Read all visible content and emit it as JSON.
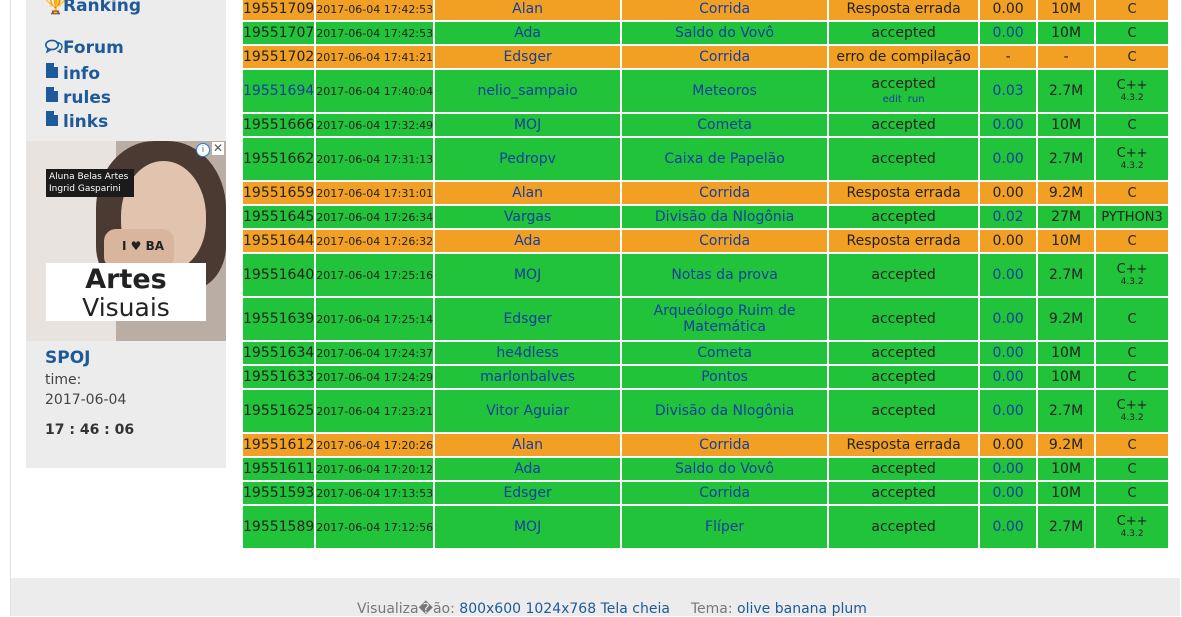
{
  "nav": {
    "ranking": "Ranking",
    "forum": "Forum",
    "info": "info",
    "rules": "rules",
    "links": "links"
  },
  "ad": {
    "caption": "Aluna Belas Artes Ingrid Gasparini",
    "headline": "Artes",
    "subline": "Visuais",
    "hand_text": "I ♥ BA"
  },
  "sidebar": {
    "title": "SPOJ",
    "time_label": "time:",
    "date": "2017-06-04",
    "clock": "17 : 46 : 06"
  },
  "submissions": [
    {
      "id": "19551709",
      "date": "2017-06-04 17:42:53",
      "user": "Alan",
      "problem": "Corrida",
      "result": "Resposta errada",
      "time": "0.00",
      "mem": "10M",
      "lang": "C",
      "lang_ver": "",
      "status": "wa",
      "id_link": false,
      "time_link": false
    },
    {
      "id": "19551707",
      "date": "2017-06-04 17:42:53",
      "user": "Ada",
      "problem": "Saldo do Vovô",
      "result": "accepted",
      "time": "0.00",
      "mem": "10M",
      "lang": "C",
      "lang_ver": "",
      "status": "ok",
      "id_link": false,
      "time_link": true
    },
    {
      "id": "19551702",
      "date": "2017-06-04 17:41:21",
      "user": "Edsger",
      "problem": "Corrida",
      "result": "erro de compilação",
      "time": "-",
      "mem": "-",
      "lang": "C",
      "lang_ver": "",
      "status": "wa",
      "id_link": false,
      "time_link": false
    },
    {
      "id": "19551694",
      "date": "2017-06-04 17:40:04",
      "user": "nelio_sampaio",
      "problem": "Meteoros",
      "result": "accepted",
      "result_edit": "edit",
      "result_run": "run",
      "time": "0.03",
      "mem": "2.7M",
      "lang": "C++",
      "lang_ver": "4.3.2",
      "status": "ok",
      "id_link": true,
      "time_link": true
    },
    {
      "id": "19551666",
      "date": "2017-06-04 17:32:49",
      "user": "MOJ",
      "problem": "Cometa",
      "result": "accepted",
      "time": "0.00",
      "mem": "10M",
      "lang": "C",
      "lang_ver": "",
      "status": "ok",
      "id_link": false,
      "time_link": true
    },
    {
      "id": "19551662",
      "date": "2017-06-04 17:31:13",
      "user": "Pedropv",
      "problem": "Caixa de Papelão",
      "result": "accepted",
      "time": "0.00",
      "mem": "2.7M",
      "lang": "C++",
      "lang_ver": "4.3.2",
      "status": "ok",
      "id_link": false,
      "time_link": true
    },
    {
      "id": "19551659",
      "date": "2017-06-04 17:31:01",
      "user": "Alan",
      "problem": "Corrida",
      "result": "Resposta errada",
      "time": "0.00",
      "mem": "9.2M",
      "lang": "C",
      "lang_ver": "",
      "status": "wa",
      "id_link": false,
      "time_link": false
    },
    {
      "id": "19551645",
      "date": "2017-06-04 17:26:34",
      "user": "Vargas",
      "problem": "Divisão da Nlogônia",
      "result": "accepted",
      "time": "0.02",
      "mem": "27M",
      "lang": "PYTHON3",
      "lang_ver": "",
      "status": "ok",
      "id_link": false,
      "time_link": true
    },
    {
      "id": "19551644",
      "date": "2017-06-04 17:26:32",
      "user": "Ada",
      "problem": "Corrida",
      "result": "Resposta errada",
      "time": "0.00",
      "mem": "10M",
      "lang": "C",
      "lang_ver": "",
      "status": "wa",
      "id_link": false,
      "time_link": false
    },
    {
      "id": "19551640",
      "date": "2017-06-04 17:25:16",
      "user": "MOJ",
      "problem": "Notas da prova",
      "result": "accepted",
      "time": "0.00",
      "mem": "2.7M",
      "lang": "C++",
      "lang_ver": "4.3.2",
      "status": "ok",
      "id_link": false,
      "time_link": true
    },
    {
      "id": "19551639",
      "date": "2017-06-04 17:25:14",
      "user": "Edsger",
      "problem": "Arqueólogo Ruim de",
      "problem2": "Matemática",
      "result": "accepted",
      "time": "0.00",
      "mem": "9.2M",
      "lang": "C",
      "lang_ver": "",
      "status": "ok",
      "id_link": false,
      "time_link": true
    },
    {
      "id": "19551634",
      "date": "2017-06-04 17:24:37",
      "user": "he4dless",
      "problem": "Cometa",
      "result": "accepted",
      "time": "0.00",
      "mem": "10M",
      "lang": "C",
      "lang_ver": "",
      "status": "ok",
      "id_link": false,
      "time_link": true
    },
    {
      "id": "19551633",
      "date": "2017-06-04 17:24:29",
      "user": "marlonbalves",
      "problem": "Pontos",
      "result": "accepted",
      "time": "0.00",
      "mem": "10M",
      "lang": "C",
      "lang_ver": "",
      "status": "ok",
      "id_link": false,
      "time_link": true
    },
    {
      "id": "19551625",
      "date": "2017-06-04 17:23:21",
      "user": "Vitor Aguiar",
      "problem": "Divisão da Nlogônia",
      "result": "accepted",
      "time": "0.00",
      "mem": "2.7M",
      "lang": "C++",
      "lang_ver": "4.3.2",
      "status": "ok",
      "id_link": false,
      "time_link": true
    },
    {
      "id": "19551612",
      "date": "2017-06-04 17:20:26",
      "user": "Alan",
      "problem": "Corrida",
      "result": "Resposta errada",
      "time": "0.00",
      "mem": "9.2M",
      "lang": "C",
      "lang_ver": "",
      "status": "wa",
      "id_link": false,
      "time_link": false
    },
    {
      "id": "19551611",
      "date": "2017-06-04 17:20:12",
      "user": "Ada",
      "problem": "Saldo do Vovô",
      "result": "accepted",
      "time": "0.00",
      "mem": "10M",
      "lang": "C",
      "lang_ver": "",
      "status": "ok",
      "id_link": false,
      "time_link": true
    },
    {
      "id": "19551593",
      "date": "2017-06-04 17:13:53",
      "user": "Edsger",
      "problem": "Corrida",
      "result": "accepted",
      "time": "0.00",
      "mem": "10M",
      "lang": "C",
      "lang_ver": "",
      "status": "ok",
      "id_link": false,
      "time_link": true
    },
    {
      "id": "19551589",
      "date": "2017-06-04 17:12:56",
      "user": "MOJ",
      "problem": "Flíper",
      "result": "accepted",
      "time": "0.00",
      "mem": "2.7M",
      "lang": "C++",
      "lang_ver": "4.3.2",
      "status": "ok",
      "id_link": false,
      "time_link": true
    }
  ],
  "footer": {
    "view_label": "Visualiza�ão:",
    "view_options": [
      "800x600",
      "1024x768",
      "Tela cheia"
    ],
    "theme_label": "Tema:",
    "theme_options": [
      "olive",
      "banana",
      "plum"
    ]
  },
  "colors": {
    "accepted": "#21c33a",
    "wrong": "#f2a023",
    "link": "#1e5a99"
  }
}
